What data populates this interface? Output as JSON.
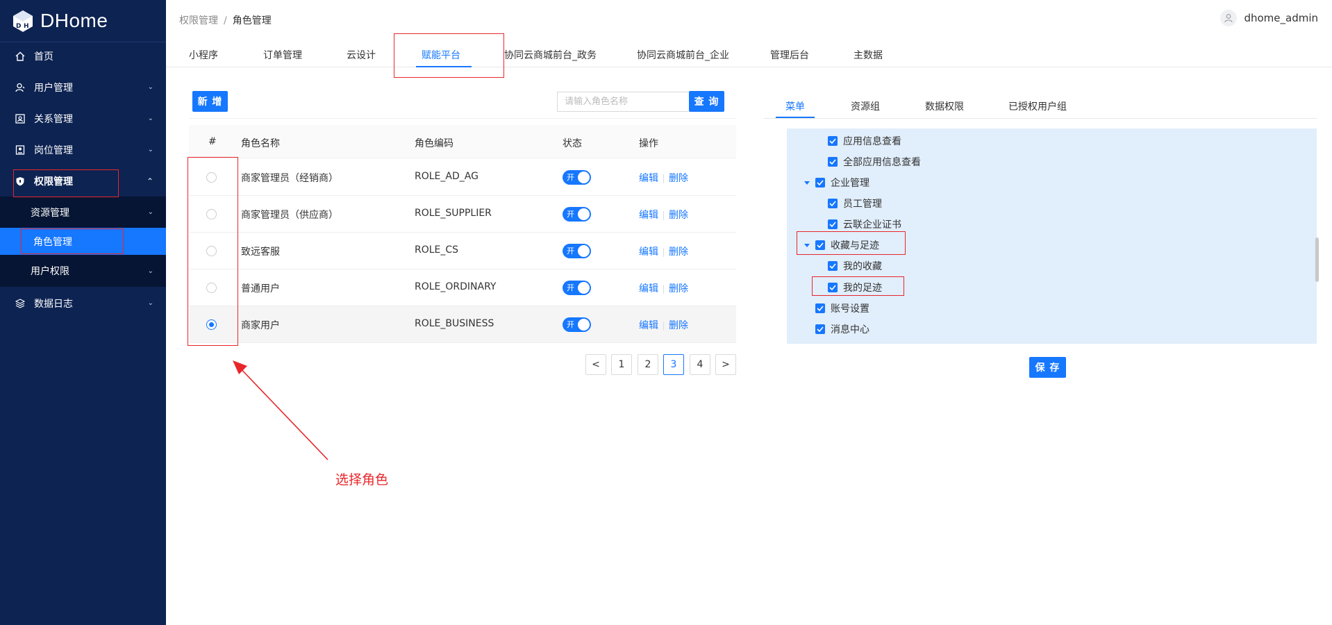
{
  "app": {
    "name": "DHome"
  },
  "sidebar": {
    "items": [
      {
        "label": "首页",
        "icon": "home-icon"
      },
      {
        "label": "用户管理",
        "icon": "user-icon"
      },
      {
        "label": "关系管理",
        "icon": "relation-icon"
      },
      {
        "label": "岗位管理",
        "icon": "badge-icon"
      },
      {
        "label": "权限管理",
        "icon": "shield-icon"
      },
      {
        "label": "资源管理"
      },
      {
        "label": "角色管理"
      },
      {
        "label": "用户权限"
      },
      {
        "label": "数据日志",
        "icon": "log-icon"
      }
    ]
  },
  "header": {
    "breadcrumb": [
      "权限管理",
      "角色管理"
    ],
    "separator": "/",
    "username": "dhome_admin"
  },
  "tabs": [
    "小程序",
    "订单管理",
    "云设计",
    "赋能平台",
    "协同云商城前台_政务",
    "协同云商城前台_企业",
    "管理后台",
    "主数据"
  ],
  "active_tab": "赋能平台",
  "toolbar": {
    "add_label": "新 增",
    "search_placeholder": "请输入角色名称",
    "search_label": "查 询"
  },
  "table": {
    "columns": [
      "#",
      "角色名称",
      "角色编码",
      "状态",
      "操作"
    ],
    "rows": [
      {
        "name": "商家管理员（经销商）",
        "code": "ROLE_AD_AG",
        "status": "开",
        "selected": false
      },
      {
        "name": "商家管理员（供应商）",
        "code": "ROLE_SUPPLIER",
        "status": "开",
        "selected": false
      },
      {
        "name": "致远客服",
        "code": "ROLE_CS",
        "status": "开",
        "selected": false
      },
      {
        "name": "普通用户",
        "code": "ROLE_ORDINARY",
        "status": "开",
        "selected": false
      },
      {
        "name": "商家用户",
        "code": "ROLE_BUSINESS",
        "status": "开",
        "selected": true
      }
    ],
    "edit_label": "编辑",
    "delete_label": "删除"
  },
  "pagination": {
    "prev": "<",
    "next": ">",
    "pages": [
      "1",
      "2",
      "3",
      "4"
    ],
    "current": "3"
  },
  "right_panel": {
    "tabs": [
      "菜单",
      "资源组",
      "数据权限",
      "已授权用户组"
    ],
    "active_tab": "菜单",
    "tree": [
      {
        "label": "应用信息查看",
        "checked": true
      },
      {
        "label": "全部应用信息查看",
        "checked": true
      },
      {
        "label": "企业管理",
        "checked": true,
        "expanded": true
      },
      {
        "label": "员工管理",
        "checked": true
      },
      {
        "label": "云联企业证书",
        "checked": true
      },
      {
        "label": "收藏与足迹",
        "checked": true,
        "expanded": true
      },
      {
        "label": "我的收藏",
        "checked": true
      },
      {
        "label": "我的足迹",
        "checked": true
      },
      {
        "label": "账号设置",
        "checked": true
      },
      {
        "label": "消息中心",
        "checked": true
      }
    ],
    "save_label": "保 存"
  },
  "annotation": {
    "text": "选择角色",
    "color": "#e8262a"
  },
  "colors": {
    "sidebar_bg": "#0d2352",
    "primary": "#1677ff",
    "tree_bg": "#e1eefb"
  }
}
